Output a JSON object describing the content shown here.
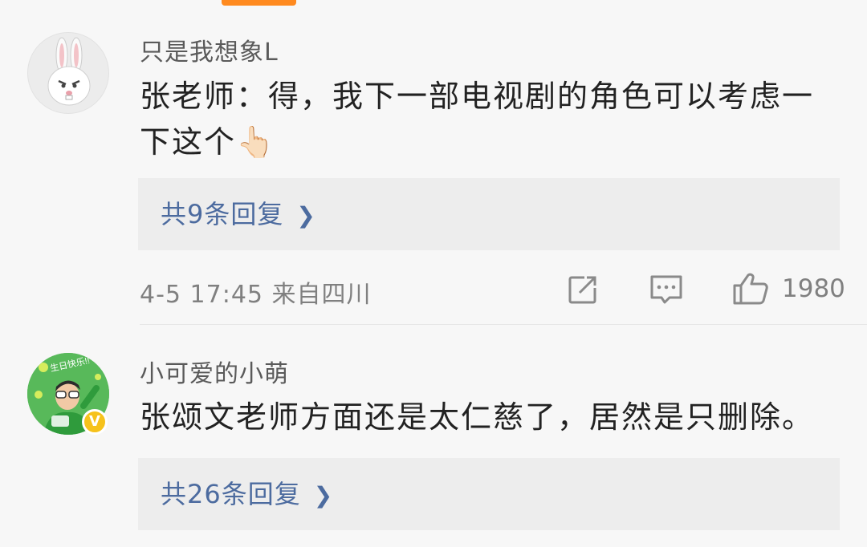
{
  "comments": [
    {
      "username": "只是我想象L",
      "text": "张老师：得，我下一部电视剧的角色可以考虑一下这个👆🏻",
      "replies_label": "共9条回复",
      "meta": "4-5 17:45 来自四川",
      "like_count": "1980",
      "avatar_icon": "white-rabbit-avatar-icon"
    },
    {
      "username": "小可爱的小萌",
      "text": "张颂文老师方面还是太仁慈了，居然是只删除。",
      "replies_label": "共26条回复",
      "avatar_icon": "green-photo-avatar-icon",
      "avatar_caption": "生日快乐!!",
      "badge_label": "V"
    }
  ],
  "icons": {
    "repost": "repost-icon",
    "comment": "comment-icon",
    "like": "thumbs-up-icon",
    "reply_more": "chevron-right-icon"
  },
  "colors": {
    "link": "#4c6b9f",
    "accent": "#ff8a1f",
    "verified_badge": "#f6c21c"
  }
}
